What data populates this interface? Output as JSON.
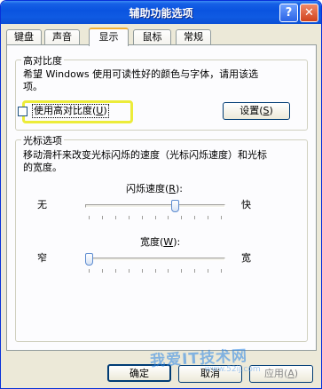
{
  "window": {
    "title": "辅助功能选项"
  },
  "tabs": [
    {
      "label": "键盘"
    },
    {
      "label": "声音"
    },
    {
      "label": "显示"
    },
    {
      "label": "鼠标"
    },
    {
      "label": "常规"
    }
  ],
  "active_tab": "显示",
  "high_contrast": {
    "legend": "高对比度",
    "description_line1": "希望 Windows 使用可读性好的颜色与字体，请用该选",
    "description_line2": "项。",
    "checkbox_label": "使用高对比度",
    "checkbox_hotkey": "U",
    "checked": false,
    "settings_button": "设置",
    "settings_hotkey": "S"
  },
  "cursor_options": {
    "legend": "光标选项",
    "description_line1": "移动滑杆来改变光标闪烁的速度（光标闪烁速度）和光标",
    "description_line2": "的宽度。",
    "blink": {
      "label": "闪烁速度",
      "hotkey": "R",
      "min_label": "无",
      "max_label": "快",
      "value_fraction": 0.65
    },
    "width": {
      "label": "宽度",
      "hotkey": "W",
      "min_label": "窄",
      "max_label": "宽",
      "value_fraction": 0.0
    }
  },
  "buttons": {
    "ok": "确定",
    "cancel": "取消",
    "apply": "应用",
    "apply_hotkey": "A"
  },
  "watermark": {
    "text": "我爱IT技术网",
    "url": "www.52ij.com"
  }
}
